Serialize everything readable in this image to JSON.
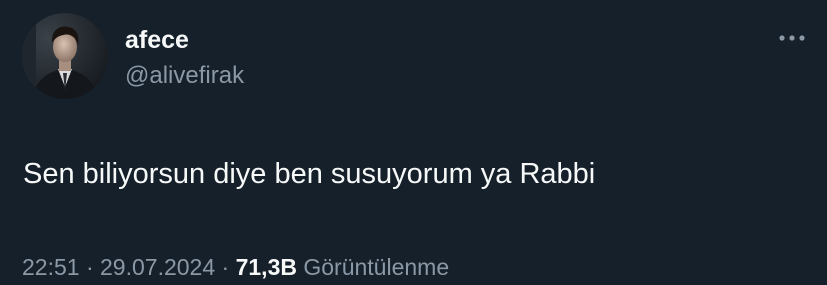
{
  "tweet": {
    "author": {
      "display_name": "afece",
      "handle": "@alivefirak",
      "avatar_icon": "profile-photo"
    },
    "more_icon": "more-dots-icon",
    "text": "Sen biliyorsun diye ben susuyorum ya Rabbi",
    "meta": {
      "time": "22:51",
      "separator": " · ",
      "date": "29.07.2024",
      "views_count": "71,3B",
      "views_label": "Görüntülenme"
    }
  },
  "colors": {
    "background": "#15202b",
    "primary_text": "#f7f9f9",
    "secondary_text": "#8b98a5"
  }
}
